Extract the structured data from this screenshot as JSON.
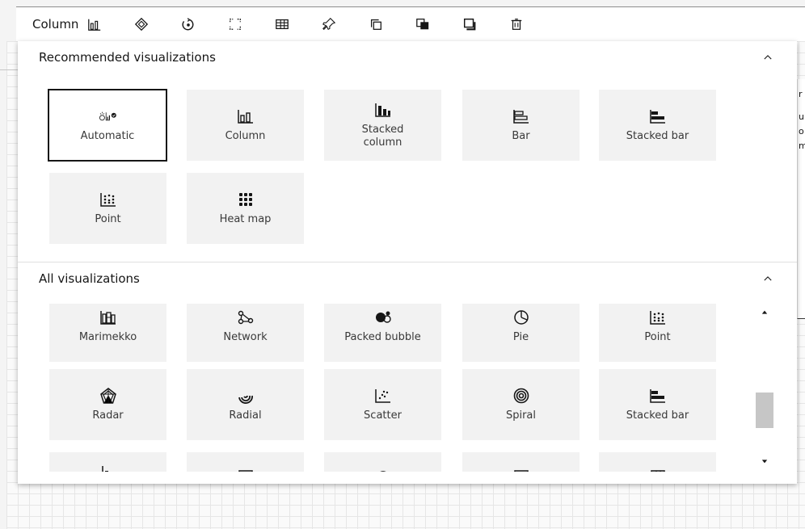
{
  "toolbar": {
    "label": "Column",
    "icons": [
      "column-chart-icon",
      "layers-icon",
      "rotate-icon",
      "fit-screen-icon",
      "table-icon",
      "pin-icon",
      "copy-icon",
      "bring-to-front-icon",
      "send-to-back-icon",
      "delete-icon"
    ]
  },
  "recommended": {
    "title": "Recommended visualizations",
    "tiles": [
      {
        "label": "Automatic",
        "icon": "automatic-icon",
        "selected": true
      },
      {
        "label": "Column",
        "icon": "column-chart-icon"
      },
      {
        "label": "Stacked column",
        "icon": "stacked-column-icon"
      },
      {
        "label": "Bar",
        "icon": "bar-chart-icon"
      },
      {
        "label": "Stacked bar",
        "icon": "stacked-bar-icon"
      },
      {
        "label": "Point",
        "icon": "point-chart-icon"
      },
      {
        "label": "Heat map",
        "icon": "heat-map-icon"
      }
    ]
  },
  "all": {
    "title": "All visualizations",
    "tiles": [
      {
        "label": "Marimekko",
        "icon": "marimekko-icon"
      },
      {
        "label": "Network",
        "icon": "network-icon"
      },
      {
        "label": "Packed bubble",
        "icon": "packed-bubble-icon"
      },
      {
        "label": "Pie",
        "icon": "pie-chart-icon"
      },
      {
        "label": "Point",
        "icon": "point-chart-icon"
      },
      {
        "label": "Radar",
        "icon": "radar-chart-icon"
      },
      {
        "label": "Radial",
        "icon": "radial-chart-icon"
      },
      {
        "label": "Scatter",
        "icon": "scatter-chart-icon"
      },
      {
        "label": "Spiral",
        "icon": "spiral-chart-icon"
      },
      {
        "label": "Stacked bar",
        "icon": "stacked-bar-icon"
      },
      {
        "label": "",
        "icon": "waterfall-icon"
      },
      {
        "label": "",
        "icon": "area-icon"
      },
      {
        "label": "",
        "icon": "gauge-icon"
      },
      {
        "label": "",
        "icon": "table-icon"
      },
      {
        "label": "",
        "icon": "tree-map-icon"
      }
    ]
  },
  "colors": {
    "selected_border": "#161616",
    "tile_bg": "#f2f2f2",
    "scroll_thumb": "#c6c6c6"
  }
}
